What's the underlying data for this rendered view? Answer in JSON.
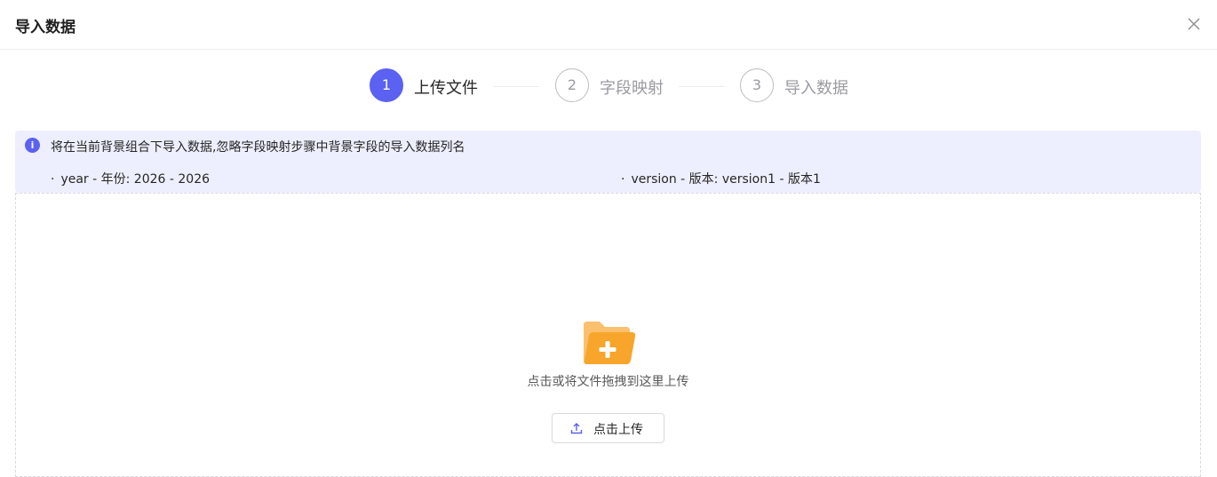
{
  "dialog": {
    "title": "导入数据",
    "close_icon": "close-icon"
  },
  "steps": [
    {
      "number": "1",
      "label": "上传文件",
      "status": "active"
    },
    {
      "number": "2",
      "label": "字段映射",
      "status": "pending"
    },
    {
      "number": "3",
      "label": "导入数据",
      "status": "pending"
    }
  ],
  "info": {
    "icon": "info-icon",
    "icon_glyph": "i",
    "message": "将在当前背景组合下导入数据,忽略字段映射步骤中背景字段的导入数据列名",
    "bullet": "·",
    "items": [
      "year - 年份: 2026 - 2026",
      "version - 版本: version1 - 版本1"
    ]
  },
  "upload": {
    "icon": "folder-plus-icon",
    "hint": "点击或将文件拖拽到这里上传",
    "button_label": "点击上传",
    "button_icon": "upload-icon"
  },
  "colors": {
    "accent": "#5b61f0",
    "info_bg": "#edeffe",
    "folder": "#f5a623"
  }
}
